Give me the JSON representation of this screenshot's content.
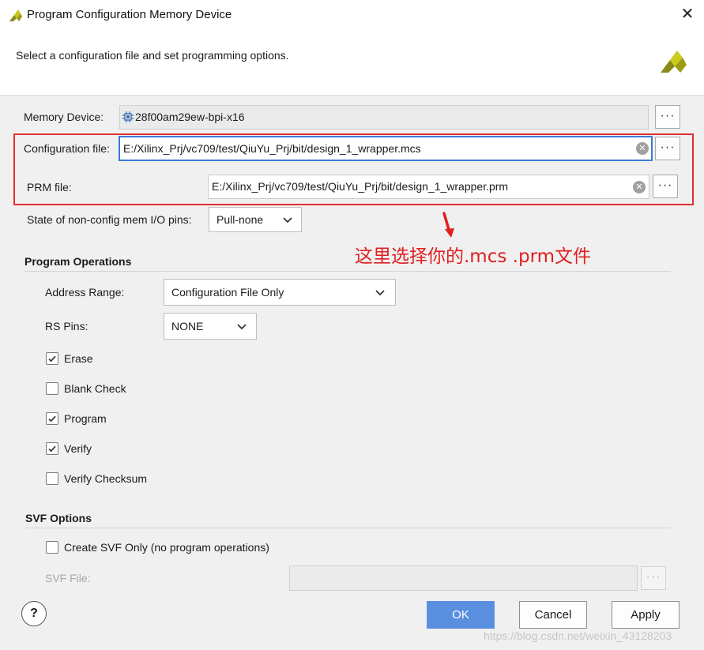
{
  "window": {
    "title": "Program Configuration Memory Device",
    "close_glyph": "✕"
  },
  "header": {
    "description": "Select a configuration file and set programming options."
  },
  "memory_device": {
    "label": "Memory Device:",
    "value": "28f00am29ew-bpi-x16",
    "browse_label": "···"
  },
  "config_file": {
    "label": "Configuration file:",
    "value": "E:/Xilinx_Prj/vc709/test/QiuYu_Prj/bit/design_1_wrapper.mcs",
    "browse_label": "···",
    "clear_glyph": "✕"
  },
  "prm_file": {
    "label": "PRM file:",
    "value": "E:/Xilinx_Prj/vc709/test/QiuYu_Prj/bit/design_1_wrapper.prm",
    "browse_label": "···",
    "clear_glyph": "✕"
  },
  "io_pins": {
    "label": "State of non-config mem I/O pins:",
    "value": "Pull-none"
  },
  "program_operations": {
    "title": "Program Operations",
    "address_range": {
      "label": "Address Range:",
      "value": "Configuration File Only"
    },
    "rs_pins": {
      "label": "RS Pins:",
      "value": "NONE"
    },
    "options": [
      {
        "label": "Erase",
        "checked": true
      },
      {
        "label": "Blank Check",
        "checked": false
      },
      {
        "label": "Program",
        "checked": true
      },
      {
        "label": "Verify",
        "checked": true
      },
      {
        "label": "Verify Checksum",
        "checked": false
      }
    ]
  },
  "svf_options": {
    "title": "SVF Options",
    "create_svf_only": {
      "label": "Create SVF Only (no program operations)",
      "checked": false
    },
    "svf_file": {
      "label": "SVF File:",
      "value": "",
      "browse_label": "···"
    }
  },
  "buttons": {
    "help": "?",
    "ok": "OK",
    "cancel": "Cancel",
    "apply": "Apply"
  },
  "annotation": {
    "text": "这里选择你的.mcs  .prm文件"
  },
  "watermark": "https://blog.csdn.net/weixin_43128203",
  "colors": {
    "accent": "#5a8fe0",
    "focus_border": "#3d7bd6",
    "annotation_red": "#e02020",
    "logo_yellow": "#b5b51c"
  },
  "icons": {
    "app": "xilinx-logo-icon",
    "chip": "chip-icon"
  }
}
